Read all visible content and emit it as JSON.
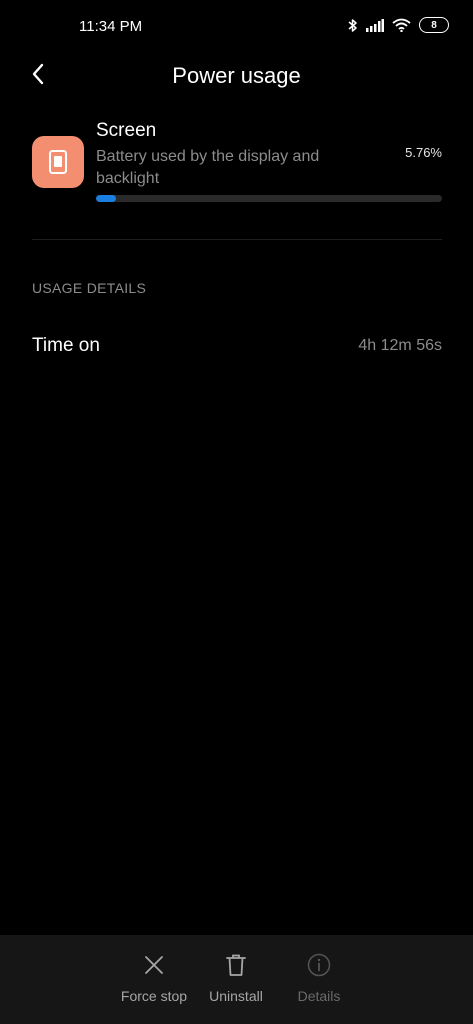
{
  "status_bar": {
    "time": "11:34 PM",
    "battery_level": "8",
    "icons": [
      "bluetooth-icon",
      "signal-icon",
      "wifi-icon",
      "battery-icon"
    ]
  },
  "header": {
    "title": "Power usage",
    "back_icon": "chevron-left-icon"
  },
  "usage_item": {
    "icon": "tablet-screen-icon",
    "icon_color": "#f48e70",
    "title": "Screen",
    "description": "Battery used by the display and backlight",
    "percent": "5.76%",
    "progress_fraction": 0.0576,
    "progress_color": "#1a7fe0"
  },
  "usage_details": {
    "section_label": "USAGE DETAILS",
    "rows": [
      {
        "label": "Time on",
        "value": "4h 12m 56s"
      }
    ]
  },
  "bottom_bar": {
    "actions": [
      {
        "label": "Force stop",
        "icon": "close-icon",
        "enabled": true
      },
      {
        "label": "Uninstall",
        "icon": "trash-icon",
        "enabled": true
      },
      {
        "label": "Details",
        "icon": "info-icon",
        "enabled": false
      }
    ]
  }
}
